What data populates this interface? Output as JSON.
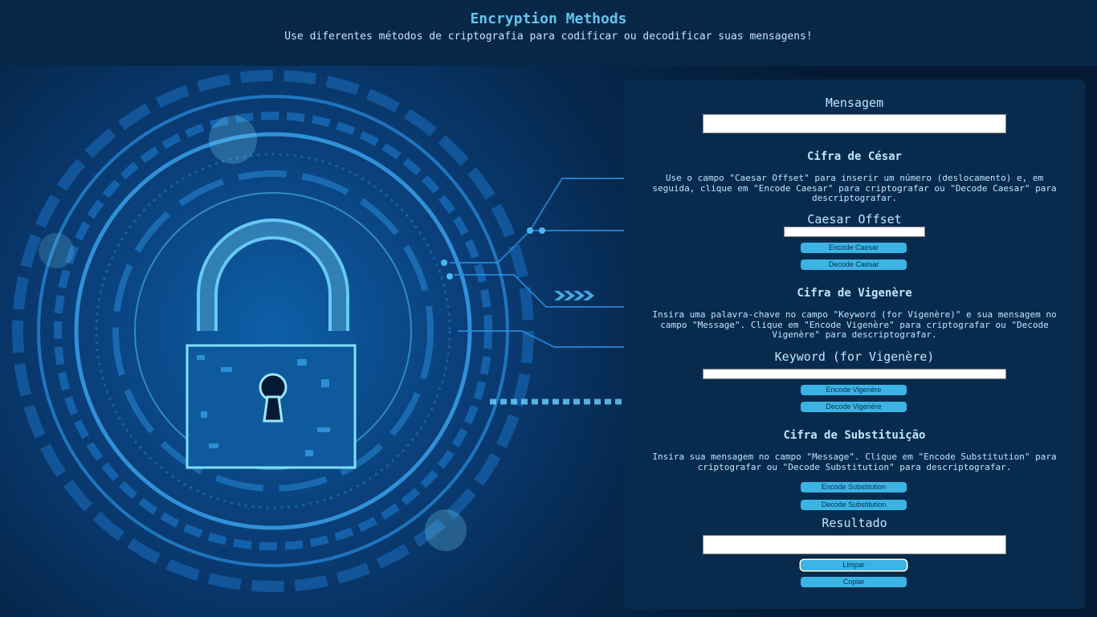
{
  "header": {
    "title": "Encryption Methods",
    "subtitle": "Use diferentes métodos de criptografia para codificar ou decodificar suas mensagens!"
  },
  "colors": {
    "header_bg": "#072747",
    "panel_bg": "#082b4d",
    "accent": "#3bb4e3",
    "title": "#63c6ee",
    "text": "#bfe6ff"
  },
  "illustration": {
    "icon": "padlock-icon"
  },
  "form": {
    "message": {
      "label": "Mensagem",
      "value": ""
    },
    "caesar": {
      "title": "Cifra de César",
      "description": "Use o campo \"Caesar Offset\" para inserir um número (deslocamento) e, em seguida, clique em \"Encode Caesar\" para criptografar ou \"Decode Caesar\" para descriptografar.",
      "offset_label": "Caesar Offset",
      "offset_value": "",
      "encode_label": "Encode Caesar",
      "decode_label": "Decode Caesar"
    },
    "vigenere": {
      "title": "Cifra de Vigenère",
      "description": "Insira uma palavra-chave no campo \"Keyword (for Vigenère)\" e sua mensagem no campo \"Message\". Clique em \"Encode Vigenère\" para criptografar ou \"Decode Vigenère\" para descriptografar.",
      "keyword_label": "Keyword (for Vigenère)",
      "keyword_value": "",
      "encode_label": "Encode Vigenère",
      "decode_label": "Decode Vigenère"
    },
    "substitution": {
      "title": "Cifra de Substituição",
      "description": "Insira sua mensagem no campo \"Message\". Clique em \"Encode Substitution\" para criptografar ou \"Decode Substitution\" para descriptografar.",
      "encode_label": "Encode Substitution",
      "decode_label": "Decode Substitution"
    },
    "result": {
      "label": "Resultado",
      "value": "",
      "clear_label": "Limpar",
      "copy_label": "Copiar"
    }
  }
}
